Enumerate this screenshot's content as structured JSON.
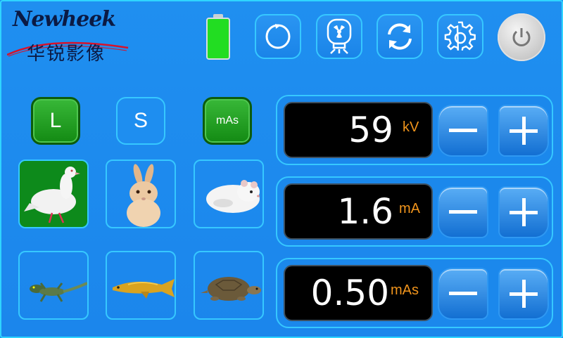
{
  "brand": {
    "name_en": "Newheek",
    "name_cn": "华锐影像"
  },
  "status": {
    "battery_level": 1.0,
    "battery_color": "#22dd22"
  },
  "toolbar": {
    "buttons": [
      {
        "id": "reset",
        "icon": "circle-reset-icon"
      },
      {
        "id": "radiation",
        "icon": "radiation-tube-icon"
      },
      {
        "id": "refresh",
        "icon": "refresh-icon"
      },
      {
        "id": "settings",
        "icon": "gear-icon"
      },
      {
        "id": "power",
        "icon": "power-icon"
      }
    ]
  },
  "modes": {
    "L": {
      "label": "L",
      "active": true
    },
    "S": {
      "label": "S",
      "active": false
    },
    "mas": {
      "label": "mAs",
      "active": true
    }
  },
  "animals": [
    {
      "name": "pigeon",
      "selected": true
    },
    {
      "name": "rabbit",
      "selected": false
    },
    {
      "name": "hamster",
      "selected": false
    },
    {
      "name": "lizard",
      "selected": false
    },
    {
      "name": "arowana-fish",
      "selected": false
    },
    {
      "name": "turtle",
      "selected": false
    }
  ],
  "params": {
    "kv": {
      "value": "59",
      "unit": "kV",
      "minus": "−",
      "plus": "+"
    },
    "ma": {
      "value": "1.6",
      "unit": "mA",
      "minus": "−",
      "plus": "+"
    },
    "mas": {
      "value": "0.50",
      "unit": "mAs",
      "minus": "−",
      "plus": "+"
    }
  },
  "colors": {
    "background": "#1e90f0",
    "accent_border": "#36c8ff",
    "unit_orange": "#f0941c",
    "active_green": "#138a13"
  }
}
